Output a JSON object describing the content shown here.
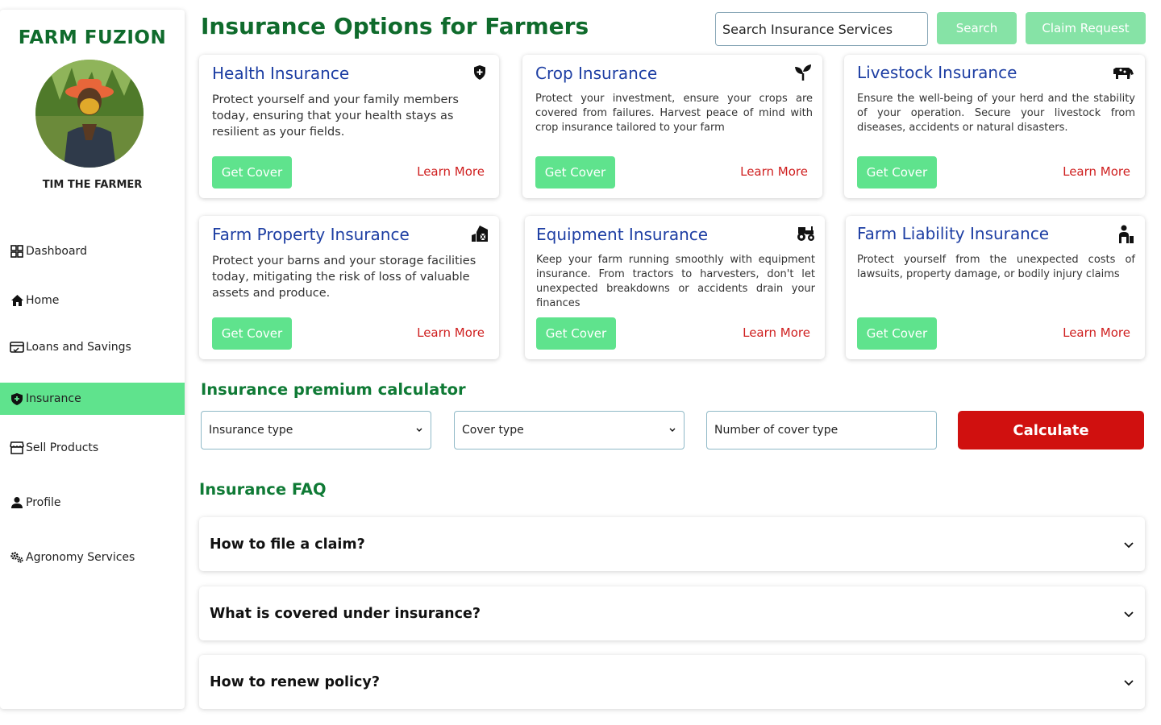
{
  "sidebar": {
    "brand": "FARM FUZION",
    "username": "TIM THE FARMER",
    "items": [
      {
        "label": "Dashboard",
        "icon": "grid-icon"
      },
      {
        "label": "Home",
        "icon": "home-icon"
      },
      {
        "label": "Loans and Savings",
        "icon": "card-icon"
      },
      {
        "label": "Insurance",
        "icon": "shield-icon",
        "active": true
      },
      {
        "label": "Sell Products",
        "icon": "store-icon"
      },
      {
        "label": "Profile",
        "icon": "user-icon"
      },
      {
        "label": "Agronomy Services",
        "icon": "gears-icon"
      }
    ]
  },
  "header": {
    "title": "Insurance Options for Farmers",
    "search_placeholder": "Search Insurance Services",
    "search_label": "Search",
    "claim_label": "Claim Request"
  },
  "cards": [
    {
      "title": "Health Insurance",
      "icon": "shield-plus-icon",
      "desc": "Protect yourself and your family members today, ensuring that your health stays as resilient as your fields.",
      "cta": "Get Cover",
      "link": "Learn More"
    },
    {
      "title": "Crop Insurance",
      "icon": "sprout-icon",
      "desc": "Protect your investment, ensure your crops are covered from failures. Harvest peace of mind with crop insurance tailored to your farm",
      "cta": "Get Cover",
      "link": "Learn More"
    },
    {
      "title": "Livestock Insurance",
      "icon": "cow-icon",
      "desc": "Ensure the well-being of your herd and the stability of your operation. Secure your livestock from diseases, accidents or natural disasters.",
      "cta": "Get Cover",
      "link": "Learn More"
    },
    {
      "title": "Farm Property Insurance",
      "icon": "barn-icon",
      "desc": "Protect your barns and your storage facilities today, mitigating the risk of loss of valuable assets and produce.",
      "cta": "Get Cover",
      "link": "Learn More"
    },
    {
      "title": "Equipment Insurance",
      "icon": "tractor-icon",
      "desc": "Keep your farm running smoothly with equipment insurance. From tractors to harvesters, don't let unexpected breakdowns or accidents drain your finances",
      "cta": "Get Cover",
      "link": "Learn More"
    },
    {
      "title": "Farm Liability Insurance",
      "icon": "person-liability-icon",
      "desc": "Protect yourself from the unexpected costs of lawsuits, property damage, or bodily injury claims",
      "cta": "Get Cover",
      "link": "Learn More"
    }
  ],
  "calculator": {
    "title": "Insurance premium calculator",
    "insurance_type": "Insurance type",
    "cover_type": "Cover type",
    "number_placeholder": "Number of cover type",
    "button": "Calculate"
  },
  "faq": {
    "title": "Insurance FAQ",
    "items": [
      {
        "q": "How to file a claim?"
      },
      {
        "q": "What is covered under insurance?"
      },
      {
        "q": "How to renew policy?"
      }
    ]
  },
  "colors": {
    "brand_green": "#0f6b2c",
    "active_green": "#5fe38d",
    "button_green": "#5fe38d",
    "title_blue": "#1d3ea3",
    "learn_red": "#cf1f1f",
    "calc_red": "#d0100f"
  }
}
